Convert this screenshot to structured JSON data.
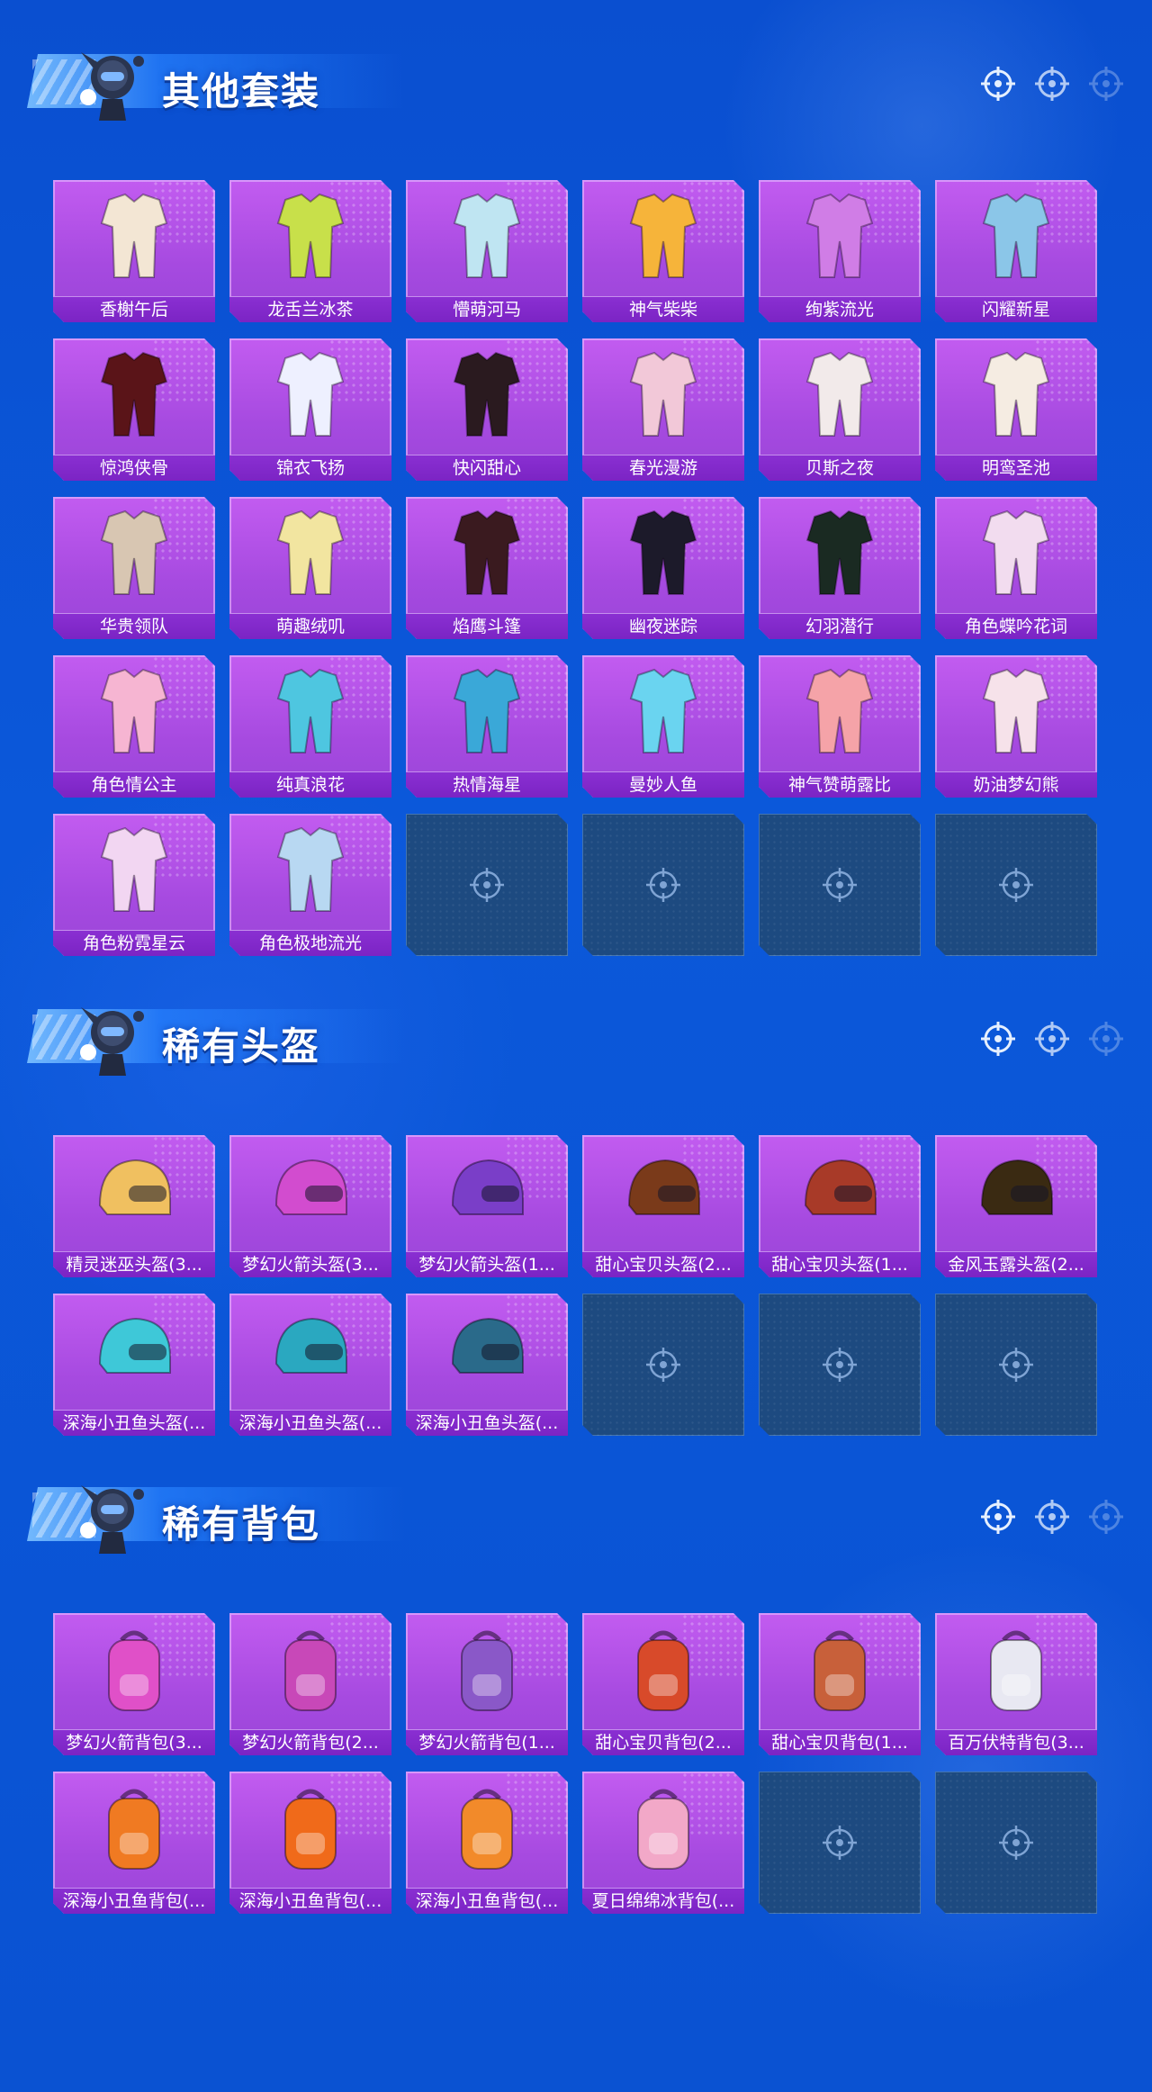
{
  "sections": [
    {
      "title": "其他套装",
      "items": [
        {
          "label": "香榭午后",
          "color": "#f3e6d4"
        },
        {
          "label": "龙舌兰冰茶",
          "color": "#c8e04a"
        },
        {
          "label": "懵萌河马",
          "color": "#bfe5f2"
        },
        {
          "label": "神气柴柴",
          "color": "#f6b43a"
        },
        {
          "label": "绚紫流光",
          "color": "#d07de6"
        },
        {
          "label": "闪耀新星",
          "color": "#8bc6e8"
        },
        {
          "label": "惊鸿侠骨",
          "color": "#5a1418"
        },
        {
          "label": "锦衣飞扬",
          "color": "#eef0ff"
        },
        {
          "label": "快闪甜心",
          "color": "#2a1a1f"
        },
        {
          "label": "春光漫游",
          "color": "#f2c8d8"
        },
        {
          "label": "贝斯之夜",
          "color": "#f2eaea"
        },
        {
          "label": "明鸾圣池",
          "color": "#f5ece2"
        },
        {
          "label": "华贵领队",
          "color": "#d8c6b2"
        },
        {
          "label": "萌趣绒叽",
          "color": "#f2e5a0"
        },
        {
          "label": "焰鹰斗篷",
          "color": "#3a1a1f"
        },
        {
          "label": "幽夜迷踪",
          "color": "#1c1a2a"
        },
        {
          "label": "幻羽潜行",
          "color": "#1a2a22"
        },
        {
          "label": "角色蝶吟花词",
          "color": "#f2dcef"
        },
        {
          "label": "角色情公主",
          "color": "#f6b5d2"
        },
        {
          "label": "纯真浪花",
          "color": "#4ec6e0"
        },
        {
          "label": "热情海星",
          "color": "#3aa8d8"
        },
        {
          "label": "曼妙人鱼",
          "color": "#6ad4f0"
        },
        {
          "label": "神气赞萌露比",
          "color": "#f5a3a8"
        },
        {
          "label": "奶油梦幻熊",
          "color": "#f6e2ea"
        },
        {
          "label": "角色粉霓星云",
          "color": "#f2d6f2"
        },
        {
          "label": "角色极地流光",
          "color": "#b8d8f2"
        },
        null,
        null,
        null,
        null
      ]
    },
    {
      "title": "稀有头盔",
      "items": [
        {
          "label": "精灵迷巫头盔(3...",
          "color": "#f0c060"
        },
        {
          "label": "梦幻火箭头盔(3...",
          "color": "#d24ccf"
        },
        {
          "label": "梦幻火箭头盔(1...",
          "color": "#7a3ec8"
        },
        {
          "label": "甜心宝贝头盔(2...",
          "color": "#7a3a1a"
        },
        {
          "label": "甜心宝贝头盔(1...",
          "color": "#a83a28"
        },
        {
          "label": "金风玉露头盔(2...",
          "color": "#3a2a12"
        },
        {
          "label": "深海小丑鱼头盔(...",
          "color": "#3ec8d8"
        },
        {
          "label": "深海小丑鱼头盔(...",
          "color": "#2aa8c0"
        },
        {
          "label": "深海小丑鱼头盔(...",
          "color": "#2a6a8a"
        },
        null,
        null,
        null
      ]
    },
    {
      "title": "稀有背包",
      "items": [
        {
          "label": "梦幻火箭背包(3...",
          "color": "#e050c8"
        },
        {
          "label": "梦幻火箭背包(2...",
          "color": "#c848b8"
        },
        {
          "label": "梦幻火箭背包(1...",
          "color": "#8a58c8"
        },
        {
          "label": "甜心宝贝背包(2...",
          "color": "#d84a2a"
        },
        {
          "label": "甜心宝贝背包(1...",
          "color": "#c8603a"
        },
        {
          "label": "百万伏特背包(3...",
          "color": "#e8e8f2"
        },
        {
          "label": "深海小丑鱼背包(...",
          "color": "#f07a22"
        },
        {
          "label": "深海小丑鱼背包(...",
          "color": "#f06a1a"
        },
        {
          "label": "深海小丑鱼背包(...",
          "color": "#f28a2a"
        },
        {
          "label": "夏日绵绵冰背包(...",
          "color": "#f2a8c8"
        },
        null,
        null
      ]
    }
  ]
}
